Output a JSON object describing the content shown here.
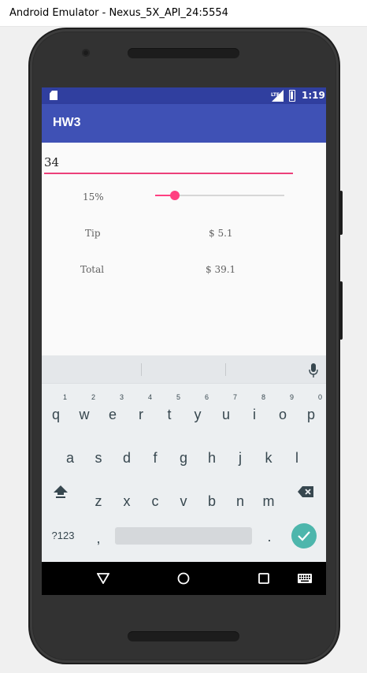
{
  "window": {
    "title": "Android Emulator - Nexus_5X_API_24:5554"
  },
  "status_bar": {
    "time": "1:19",
    "network": "LTE",
    "color": "#303f9f"
  },
  "app_bar": {
    "title": "HW3",
    "color": "#3f51b5"
  },
  "form": {
    "bill_amount": "34",
    "tip_percent_label": "15%",
    "tip_slider_fraction": 0.15,
    "tip_label": "Tip",
    "tip_value": "$ 5.1",
    "total_label": "Total",
    "total_value": "$ 39.1",
    "accent_color": "#ff4081"
  },
  "keyboard": {
    "row1": [
      {
        "key": "q",
        "hint": "1"
      },
      {
        "key": "w",
        "hint": "2"
      },
      {
        "key": "e",
        "hint": "3"
      },
      {
        "key": "r",
        "hint": "4"
      },
      {
        "key": "t",
        "hint": "5"
      },
      {
        "key": "y",
        "hint": "6"
      },
      {
        "key": "u",
        "hint": "7"
      },
      {
        "key": "i",
        "hint": "8"
      },
      {
        "key": "o",
        "hint": "9"
      },
      {
        "key": "p",
        "hint": "0"
      }
    ],
    "row2": [
      "a",
      "s",
      "d",
      "f",
      "g",
      "h",
      "j",
      "k",
      "l"
    ],
    "row3": [
      "z",
      "x",
      "c",
      "v",
      "b",
      "n",
      "m"
    ],
    "symbols_key": "?123",
    "comma_key": ",",
    "period_key": ".",
    "icons": {
      "shift": "shift-arrow-icon",
      "backspace": "backspace-icon",
      "enter": "check-icon",
      "mic": "mic-icon"
    }
  },
  "nav_bar": {
    "icons": [
      "back-triangle-icon",
      "home-circle-icon",
      "recents-square-icon",
      "keyboard-switch-icon"
    ]
  }
}
